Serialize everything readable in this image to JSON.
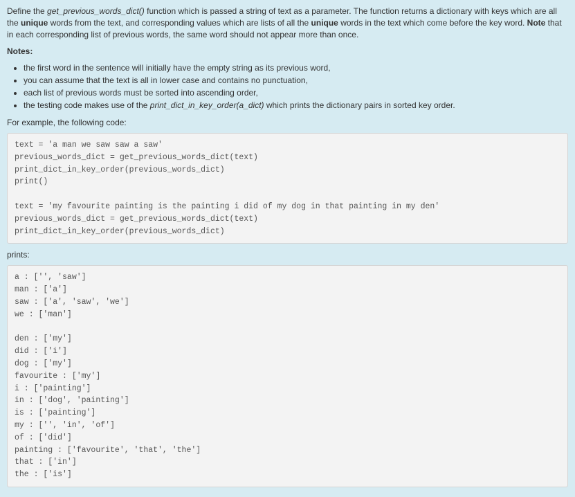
{
  "intro": {
    "p1_pre": "Define the ",
    "p1_func": "get_previous_words_dict()",
    "p1_mid1": " function which is passed a string of text as a parameter.  The function returns a dictionary with keys which are all the ",
    "p1_b1": "unique",
    "p1_mid2": " words from the text, and corresponding values which are lists of all the ",
    "p1_b2": "unique",
    "p1_mid3": " words in the text which come before the key word.  ",
    "p1_b3": "Note",
    "p1_mid4": " that in each corresponding list of previous words, the same word should not appear more than once."
  },
  "notes_label": "Notes:",
  "notes": {
    "n1": "the first word in the sentence will initially have the empty string as its previous word,",
    "n2": "you can assume that the text is all in lower case and contains no punctuation,",
    "n3": "each list of previous words must be sorted into ascending order,",
    "n4_pre": "the testing code makes use of the ",
    "n4_func": "print_dict_in_key_order(a_dict)",
    "n4_post": " which prints the dictionary pairs in sorted key order."
  },
  "example_label": "For example, the following code:",
  "code1": "text = 'a man we saw saw a saw'\nprevious_words_dict = get_previous_words_dict(text)\nprint_dict_in_key_order(previous_words_dict)\nprint()\n\ntext = 'my favourite painting is the painting i did of my dog in that painting in my den'\nprevious_words_dict = get_previous_words_dict(text)\nprint_dict_in_key_order(previous_words_dict)",
  "prints_label": "prints:",
  "code2": "a : ['', 'saw']\nman : ['a']\nsaw : ['a', 'saw', 'we']\nwe : ['man']\n\nden : ['my']\ndid : ['i']\ndog : ['my']\nfavourite : ['my']\ni : ['painting']\nin : ['dog', 'painting']\nis : ['painting']\nmy : ['', 'in', 'of']\nof : ['did']\npainting : ['favourite', 'that', 'the']\nthat : ['in']\nthe : ['is']"
}
